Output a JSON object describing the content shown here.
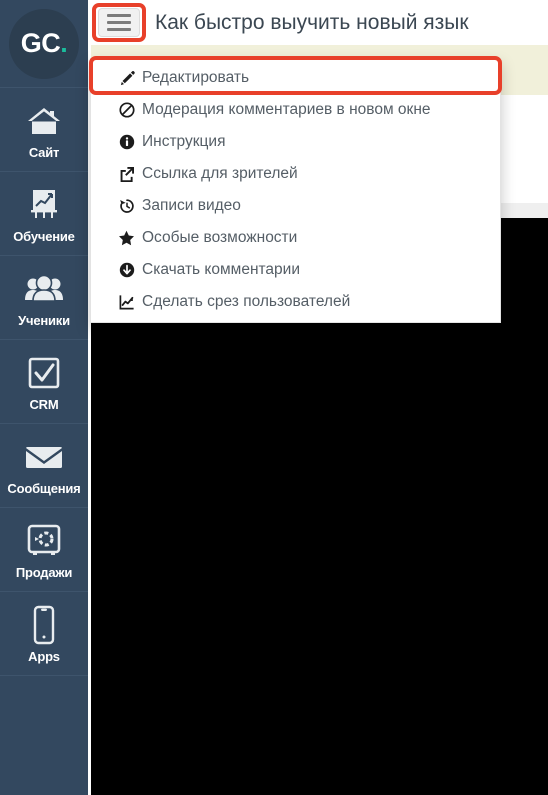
{
  "app": {
    "logo_primary": "GC",
    "logo_accent": ".",
    "accent_color": "#1abc9c",
    "sidebar_bg": "#33485f",
    "highlight_color": "#e8402a"
  },
  "header": {
    "title": "Как быстро выучить новый язык",
    "menu_button_icon": "hamburger-icon"
  },
  "sidebar": {
    "items": [
      {
        "label": "Сайт",
        "icon": "home-icon"
      },
      {
        "label": "Обучение",
        "icon": "chart-board-icon"
      },
      {
        "label": "Ученики",
        "icon": "users-icon"
      },
      {
        "label": "CRM",
        "icon": "check-square-icon"
      },
      {
        "label": "Сообщения",
        "icon": "envelope-icon"
      },
      {
        "label": "Продажи",
        "icon": "safe-icon"
      },
      {
        "label": "Apps",
        "icon": "mobile-icon"
      }
    ]
  },
  "dropdown": {
    "items": [
      {
        "label": "Редактировать",
        "icon": "pencil-icon",
        "highlighted": true
      },
      {
        "label": "Модерация комментариев в новом окне",
        "icon": "ban-icon",
        "highlighted": false
      },
      {
        "label": "Инструкция",
        "icon": "info-circle-icon",
        "highlighted": false
      },
      {
        "label": "Ссылка для зрителей",
        "icon": "external-link-icon",
        "highlighted": false
      },
      {
        "label": "Записи видео",
        "icon": "history-clock-icon",
        "highlighted": false
      },
      {
        "label": "Особые возможности",
        "icon": "star-icon",
        "highlighted": false
      },
      {
        "label": "Скачать комментарии",
        "icon": "download-circle-icon",
        "highlighted": false
      },
      {
        "label": "Сделать срез пользователей",
        "icon": "chart-line-icon",
        "highlighted": false
      }
    ]
  }
}
